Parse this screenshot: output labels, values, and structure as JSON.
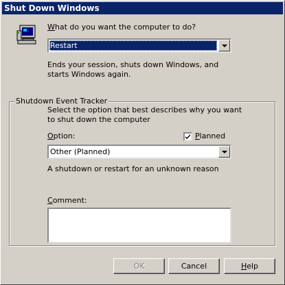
{
  "window": {
    "title": "Shut Down Windows"
  },
  "computer_icon": "computer-icon",
  "action": {
    "prompt": "What do you want the computer to do?",
    "selected": "Restart",
    "description": "Ends your session, shuts down Windows, and starts Windows again."
  },
  "tracker": {
    "group_label": "Shutdown Event Tracker",
    "instruction": "Select the option that best describes why you want to shut down the computer",
    "option_label": "Option:",
    "planned_label": "Planned",
    "planned_checked": true,
    "option_selected": "Other (Planned)",
    "option_description": "A shutdown or restart for an unknown reason",
    "comment_label": "Comment:",
    "comment_value": ""
  },
  "buttons": {
    "ok": "OK",
    "cancel": "Cancel",
    "help": "Help"
  },
  "colors": {
    "titlebar": "#0a246a",
    "face": "#d4d0c8",
    "selection": "#0a246a"
  }
}
